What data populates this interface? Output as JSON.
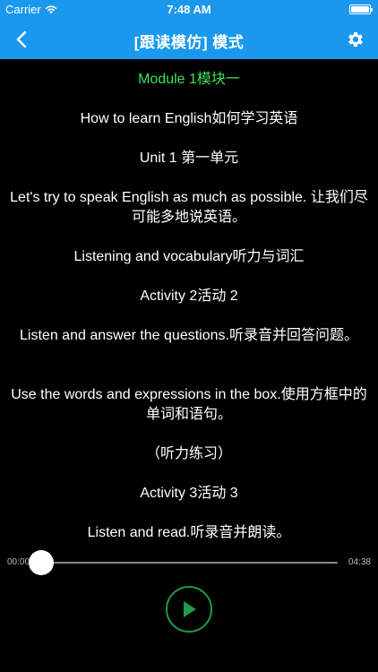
{
  "status_bar": {
    "carrier": "Carrier",
    "time": "7:48 AM"
  },
  "nav": {
    "title": "[跟读模仿] 模式",
    "back_icon": "chevron-left-icon",
    "settings_icon": "gear-icon"
  },
  "lines": [
    {
      "text": "Module 1模块一",
      "active": true
    },
    {
      "text": "How to learn English如何学习英语",
      "active": false
    },
    {
      "text": "Unit 1 第一单元",
      "active": false
    },
    {
      "text": "Let's try to speak English as much as possible. 让我们尽可能多地说英语。",
      "active": false
    },
    {
      "text": "Listening and vocabulary听力与词汇",
      "active": false
    },
    {
      "text": "Activity 2活动 2",
      "active": false
    },
    {
      "text": "Listen and answer the questions.听录音并回答问题。",
      "active": false
    },
    {
      "text": "Use the words and expressions in the box.使用方框中的单词和语句。",
      "active": false
    },
    {
      "text": "（听力练习）",
      "active": false
    },
    {
      "text": "Activity 3活动 3",
      "active": false
    },
    {
      "text": "Listen and read.听录音并朗读。",
      "active": false
    }
  ],
  "player": {
    "current_time": "00:00",
    "total_time": "04:38",
    "progress": 0.0,
    "play_icon": "play-icon"
  },
  "colors": {
    "primary": "#1a98ee",
    "active_line": "#3be05a",
    "play_accent": "#1e9b4b"
  }
}
